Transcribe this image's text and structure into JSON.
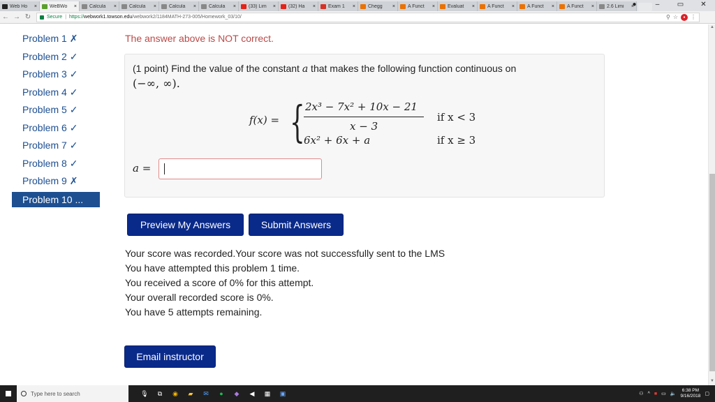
{
  "browser": {
    "tabs": [
      {
        "label": "Web Ho",
        "color": "#222222"
      },
      {
        "label": "WeBWo",
        "color": "#5aa02c",
        "active": true
      },
      {
        "label": "Calcula",
        "color": "#888888"
      },
      {
        "label": "Calcula",
        "color": "#888888"
      },
      {
        "label": "Calcula",
        "color": "#888888"
      },
      {
        "label": "Calcula",
        "color": "#888888"
      },
      {
        "label": "(33) Lim",
        "color": "#e62117"
      },
      {
        "label": "(32) Ha",
        "color": "#e62117"
      },
      {
        "label": "Exam 1",
        "color": "#d93025"
      },
      {
        "label": "Chegg",
        "color": "#eb7100"
      },
      {
        "label": "A Funct",
        "color": "#eb7100"
      },
      {
        "label": "Evaluat",
        "color": "#eb7100"
      },
      {
        "label": "A Funct",
        "color": "#eb7100"
      },
      {
        "label": "A Funct",
        "color": "#eb7100"
      },
      {
        "label": "A Funct",
        "color": "#eb7100"
      },
      {
        "label": "2.6 Limi",
        "color": "#888888"
      }
    ],
    "secure_label": "Secure",
    "url_scheme": "https://",
    "url_host": "webwork1.towson.edu",
    "url_path": "/webwork2/1184MATH-273-005/Homework_03/10/"
  },
  "sidebar": {
    "problems": [
      {
        "label": "Problem 1 ✗"
      },
      {
        "label": "Problem 2 ✓"
      },
      {
        "label": "Problem 3 ✓"
      },
      {
        "label": "Problem 4 ✓"
      },
      {
        "label": "Problem 5 ✓"
      },
      {
        "label": "Problem 6 ✓"
      },
      {
        "label": "Problem 7 ✓"
      },
      {
        "label": "Problem 8 ✓"
      },
      {
        "label": "Problem 9 ✗"
      },
      {
        "label": "Problem 10 ...",
        "current": true
      }
    ]
  },
  "problem": {
    "feedback": "The answer above is NOT correct.",
    "prompt_prefix": "(1 point) Find the value of the constant ",
    "constant": "a",
    "prompt_suffix": " that makes the following function continuous on",
    "interval": "(−∞, ∞).",
    "fx": "f(x) =",
    "numerator": "2x³ − 7x² + 10x − 21",
    "denominator": "x − 3",
    "case2_expr": "6x² + 6x + a",
    "cond1": "if x < 3",
    "cond2": "if x ≥ 3",
    "answer_label": "a =",
    "answer_value": ""
  },
  "buttons": {
    "preview": "Preview My Answers",
    "submit": "Submit Answers",
    "email": "Email instructor"
  },
  "results": {
    "lines": [
      "Your score was recorded.Your score was not successfully sent to the LMS",
      "You have attempted this problem 1 time.",
      "You received a score of 0% for this attempt.",
      "Your overall recorded score is 0%.",
      "You have 5 attempts remaining."
    ]
  },
  "taskbar": {
    "search_placeholder": "Type here to search",
    "time": "6:38 PM",
    "date": "9/16/2018"
  },
  "colors": {
    "link": "#1d4f91",
    "button": "#0a2a8a",
    "error": "#b94a48"
  }
}
